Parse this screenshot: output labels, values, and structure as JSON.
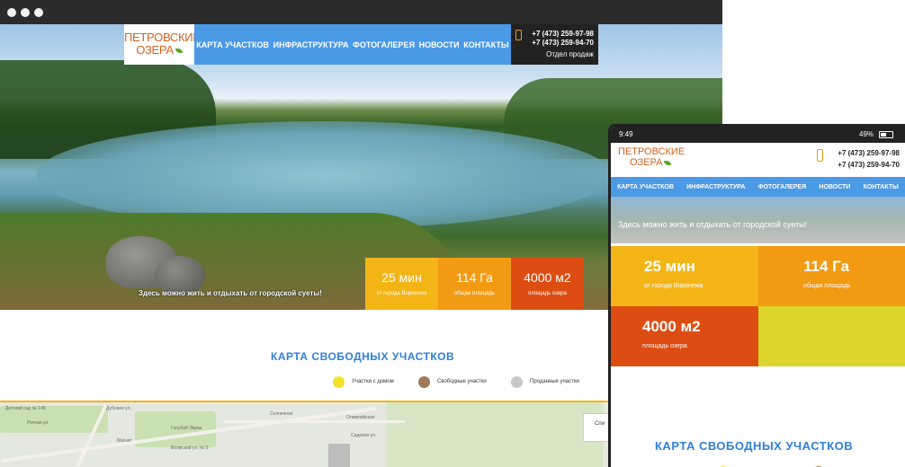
{
  "desktop": {
    "logo": {
      "line1": "ПЕТРОВСКИЕ",
      "line2": "ОЗЕРА"
    },
    "nav": [
      "КАРТА УЧАСТКОВ",
      "ИНФРАСТРУКТУРА",
      "ФОТОГАЛЕРЕЯ",
      "НОВОСТИ",
      "КОНТАКТЫ"
    ],
    "phones": [
      "+7 (473) 259-97-98",
      "+7 (473) 259-94-70"
    ],
    "sales_label": "Отдел продаж",
    "tagline": "Здесь можно жить и отдыхать от городской суеты!",
    "stats": [
      {
        "value": "25 мин",
        "label": "от города Воронежа"
      },
      {
        "value": "114 Га",
        "label": "общая площадь"
      },
      {
        "value": "4000 м2",
        "label": "площадь озера"
      }
    ],
    "map_title": "КАРТА СВОБОДНЫХ УЧАСТКОВ",
    "legend": [
      "Участки с домом",
      "Свободные участки",
      "Проданные участки"
    ],
    "map": {
      "labels": [
        "Детский сад № 148",
        "Речная ул.",
        "Дубовая ул.",
        "Голубой Экран",
        "Магнит",
        "Волжский ул. № 5",
        "Солнечная",
        "Олимпийская",
        "Садовая ул."
      ],
      "button": "Спи"
    }
  },
  "mobile": {
    "status": {
      "time": "9:49",
      "battery": "49%"
    },
    "logo": {
      "line1": "ПЕТРОВСКИЕ",
      "line2": "ОЗЕРА"
    },
    "phones": [
      "+7 (473) 259-97-98",
      "+7 (473) 259-94-70"
    ],
    "nav": [
      "КАРТА УЧАСТКОВ",
      "ИНФРАСТРУКТУРА",
      "ФОТОГАЛЕРЕЯ",
      "НОВОСТИ",
      "КОНТАКТЫ"
    ],
    "tagline": "Здесь можно жить и отдыхать от городской суеты!",
    "stats": [
      {
        "value": "25 мин",
        "label": "от города Воронежа"
      },
      {
        "value": "114 Га",
        "label": "общая площадь"
      },
      {
        "value": "4000 м2",
        "label": "площадь озера"
      }
    ],
    "map_title": "КАРТА СВОБОДНЫХ УЧАСТКОВ"
  },
  "colors": {
    "nav_blue": "#4a9ae6",
    "yellow": "#f3b516",
    "orange": "#f29a12",
    "red_orange": "#dd4d12",
    "lime": "#dcd52b",
    "title_blue": "#2f7fd9",
    "brand_orange": "#d4621f"
  }
}
